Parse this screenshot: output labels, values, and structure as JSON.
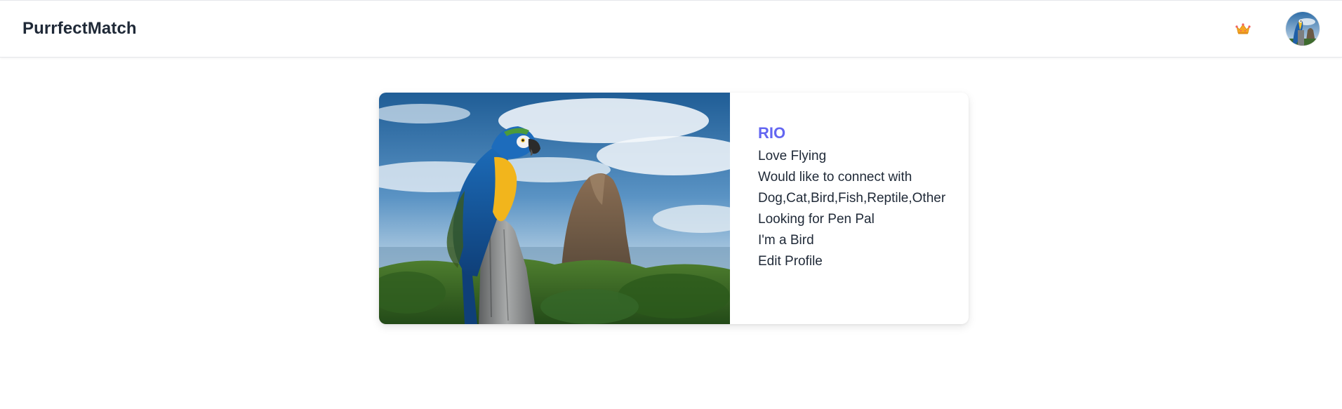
{
  "header": {
    "brand": "PurrfectMatch",
    "premium_icon": "crown-icon",
    "avatar_icon": "parrot-avatar"
  },
  "profile": {
    "photo_icon": "parrot-photo",
    "name": "RIO",
    "bio": "Love Flying",
    "connect_label": "Would like to connect with",
    "connect_types": "Dog,Cat,Bird,Fish,Reptile,Other",
    "looking_for": "Looking for Pen Pal",
    "species": "I'm a Bird",
    "edit_label": "Edit Profile"
  },
  "colors": {
    "accent": "#6366f1",
    "text": "#1f2937",
    "background": "#ffffff"
  }
}
